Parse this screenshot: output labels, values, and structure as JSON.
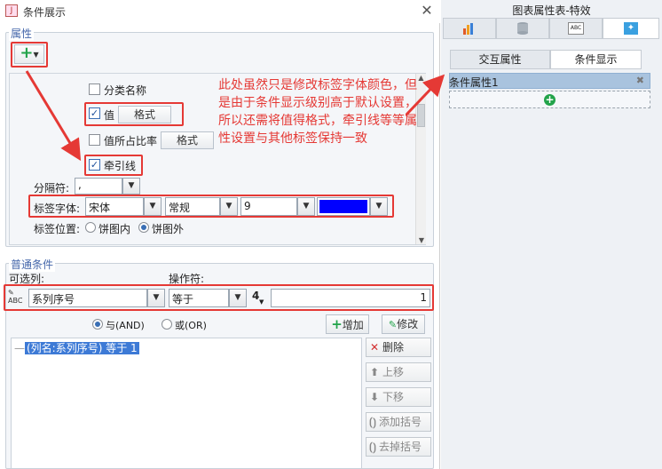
{
  "dialog": {
    "title": "条件展示",
    "close": "✕",
    "properties": {
      "title": "属性",
      "add_icon": "plus-dropdown",
      "items": {
        "category_name": {
          "label": "分类名称",
          "checked": false
        },
        "value": {
          "label": "值",
          "checked": true,
          "format": "格式"
        },
        "value_percent": {
          "label": "值所占比率",
          "checked": false,
          "format": "格式"
        },
        "leader_line": {
          "label": "牵引线",
          "checked": true
        }
      },
      "separator": {
        "label": "分隔符:",
        "value": ","
      },
      "label_font": {
        "label": "标签字体:",
        "family": "宋体",
        "style": "常规",
        "size": "9",
        "color": "#0000ff"
      },
      "label_position": {
        "label": "标签位置:",
        "options": [
          "饼图内",
          "饼图外"
        ],
        "selected": "饼图外"
      }
    },
    "annotation": "此处虽然只是修改标签字体颜色，但是由于条件显示级别高于默认设置，所以还需将值得格式，牵引线等等属性设置与其他标签保持一致",
    "conditions": {
      "title": "普通条件",
      "column_label": "可选列:",
      "operator_label": "操作符:",
      "column_value": "系列序号",
      "operator_value": "等于",
      "type_badge": "4",
      "input_value": "1",
      "and_label": "与(AND)",
      "or_label": "或(OR)",
      "selected_logic": "and",
      "add_button": "增加",
      "edit_button": "修改",
      "list_items": [
        "(列名:系列序号) 等于 1"
      ],
      "side_buttons": [
        "删除",
        "上移",
        "下移",
        "添加括号",
        "去掉括号"
      ]
    }
  },
  "right_panel": {
    "header": "图表属性表-特效",
    "icon_tabs": [
      "chart-type-icon",
      "database-icon",
      "abc-style-icon",
      "effects-icon"
    ],
    "sub_tabs": [
      "交互属性",
      "条件显示"
    ],
    "active_sub_tab": "条件显示",
    "condition_item": "条件属性1",
    "remove_icon": "✖",
    "add_icon": "plus-circle-icon"
  },
  "colors": {
    "accent": "#3a6fb5",
    "highlight": "#e53935",
    "selected_row": "#3d7ad6",
    "font_color": "#0000ff"
  }
}
